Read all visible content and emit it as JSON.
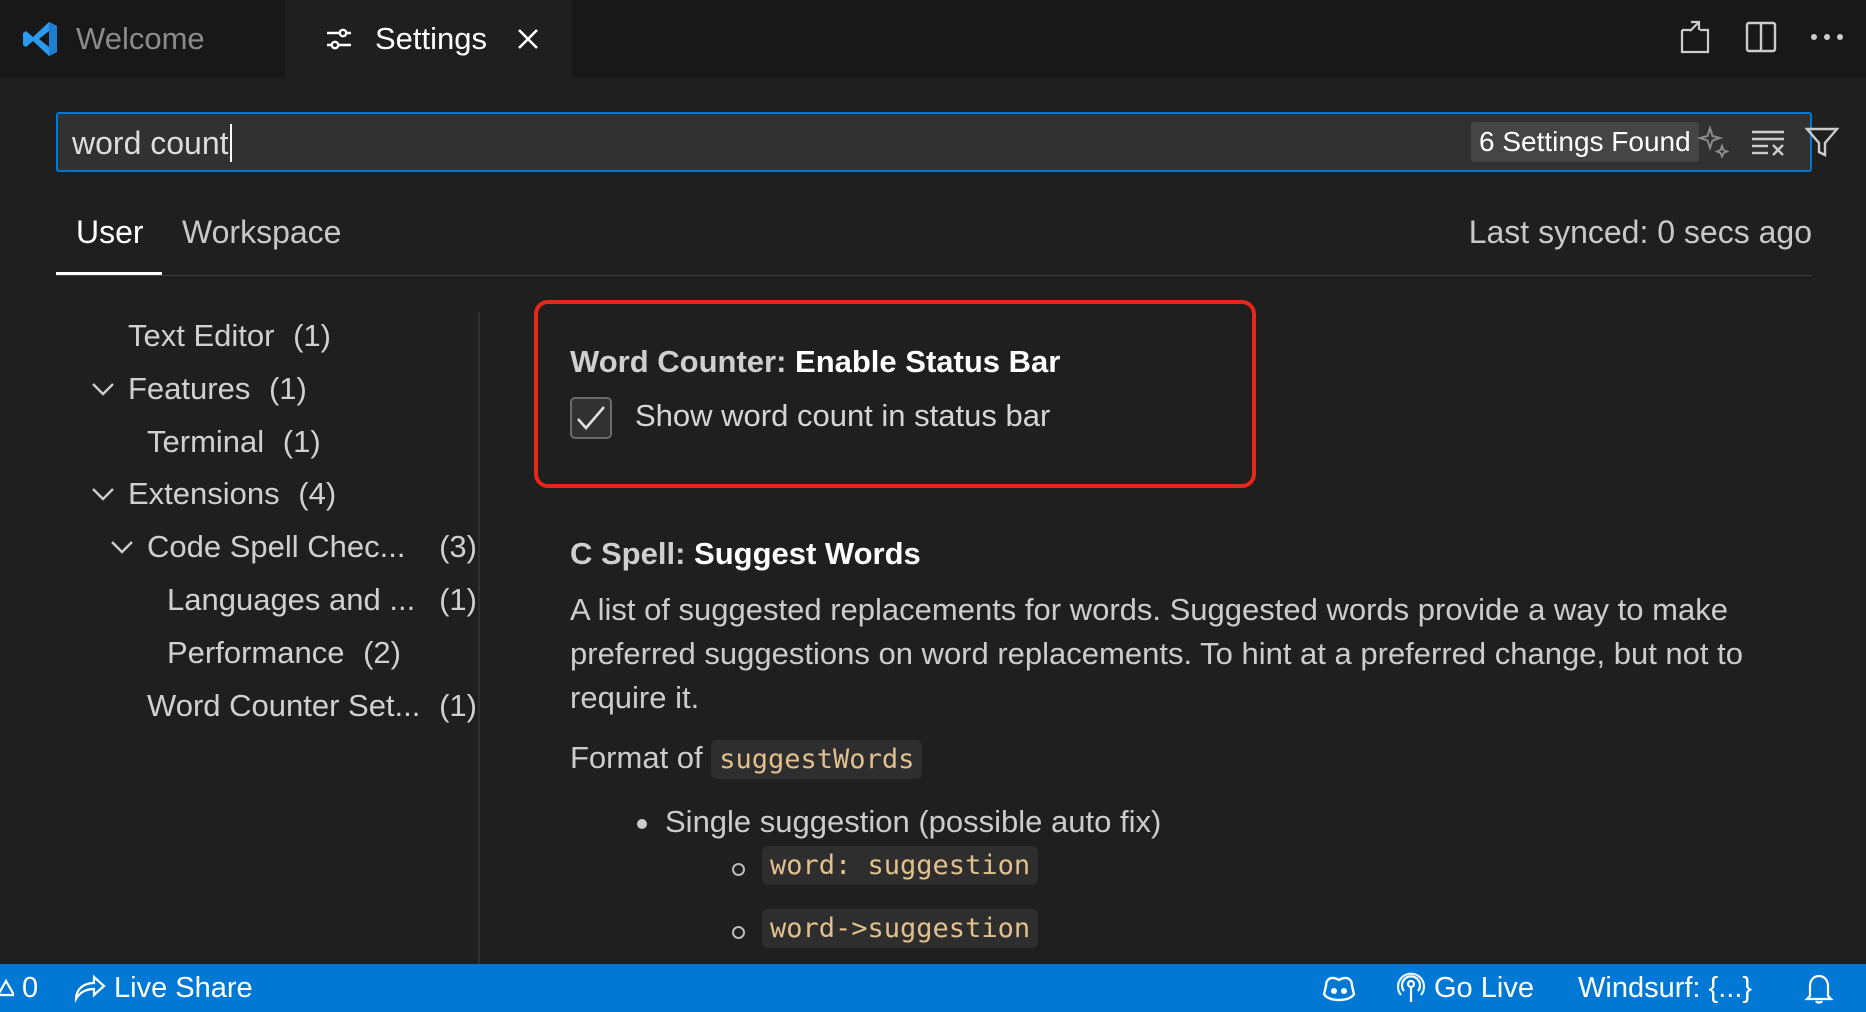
{
  "tabs": [
    {
      "label": "Welcome",
      "icon": "vscode-logo-icon",
      "active": false
    },
    {
      "label": "Settings",
      "icon": "settings-sliders-icon",
      "active": true
    }
  ],
  "editor_actions": [
    "open-settings-json-icon",
    "split-editor-icon",
    "more-actions-icon"
  ],
  "search": {
    "query": "word count",
    "results_badge": "6 Settings Found",
    "icons": [
      "ai-sparkle-icon",
      "clear-filter-icon",
      "filter-icon"
    ]
  },
  "scope_tabs": {
    "user": "User",
    "workspace": "Workspace"
  },
  "last_synced": "Last synced: 0 secs ago",
  "toc": [
    {
      "label": "Text Editor",
      "count": "(1)",
      "expanded": null
    },
    {
      "label": "Features",
      "count": "(1)",
      "expanded": true
    },
    {
      "label": "Terminal",
      "count": "(1)",
      "expanded": null
    },
    {
      "label": "Extensions",
      "count": "(4)",
      "expanded": true
    },
    {
      "label": "Code Spell Chec...",
      "count": "(3)",
      "expanded": true
    },
    {
      "label": "Languages and ...",
      "count": "(1)",
      "expanded": null
    },
    {
      "label": "Performance",
      "count": "(2)",
      "expanded": null
    },
    {
      "label": "Word Counter Set...",
      "count": "(1)",
      "expanded": null
    }
  ],
  "settings": [
    {
      "category": "Word Counter: ",
      "name": "Enable Status Bar",
      "checkbox_label": "Show word count in status bar",
      "checked": true
    },
    {
      "category": "C Spell: ",
      "name": "Suggest Words",
      "description": "A list of suggested replacements for words. Suggested words provide a way to make preferred suggestions on word replacements. To hint at a preferred change, but not to require it.",
      "format_prefix": "Format of ",
      "format_code": "suggestWords",
      "bullet": "Single suggestion (possible auto fix)",
      "sub_items": [
        "word: suggestion",
        "word->suggestion"
      ]
    }
  ],
  "statusbar": {
    "problems_count": "0",
    "live_share": "Live Share",
    "go_live": "Go Live",
    "windsurf": "Windsurf: {...}"
  },
  "colors": {
    "accent": "#0078d4",
    "highlight_border": "#e8271a",
    "code_text": "#e2c08d"
  }
}
